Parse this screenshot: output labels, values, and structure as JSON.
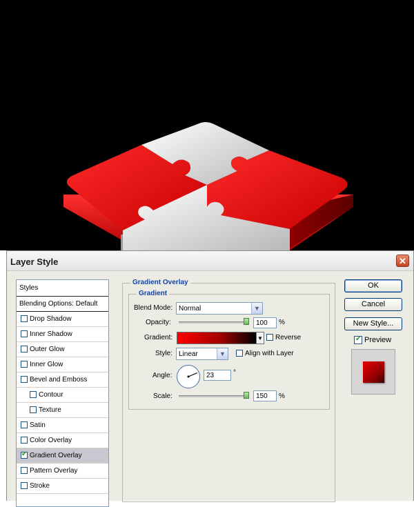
{
  "dialog": {
    "title": "Layer Style",
    "close_glyph": "✕"
  },
  "styles_panel": {
    "header": "Styles",
    "blending_options": "Blending Options: Default",
    "items": [
      {
        "label": "Drop Shadow",
        "checked": false
      },
      {
        "label": "Inner Shadow",
        "checked": false
      },
      {
        "label": "Outer Glow",
        "checked": false
      },
      {
        "label": "Inner Glow",
        "checked": false
      },
      {
        "label": "Bevel and Emboss",
        "checked": false
      },
      {
        "label": "Contour",
        "checked": false
      },
      {
        "label": "Texture",
        "checked": false
      },
      {
        "label": "Satin",
        "checked": false
      },
      {
        "label": "Color Overlay",
        "checked": false
      },
      {
        "label": "Gradient Overlay",
        "checked": true,
        "selected": true
      },
      {
        "label": "Pattern Overlay",
        "checked": false
      },
      {
        "label": "Stroke",
        "checked": false
      }
    ]
  },
  "gradient_overlay": {
    "section_title": "Gradient Overlay",
    "group_title": "Gradient",
    "blend_mode_label": "Blend Mode:",
    "blend_mode_value": "Normal",
    "opacity_label": "Opacity:",
    "opacity_value": "100",
    "opacity_percent": 100,
    "percent_sign": "%",
    "gradient_label": "Gradient:",
    "gradient_colors": [
      "#ff0000",
      "#a00000",
      "#000000"
    ],
    "reverse_label": "Reverse",
    "reverse_checked": false,
    "style_label": "Style:",
    "style_value": "Linear",
    "align_label": "Align with Layer",
    "align_checked": false,
    "angle_label": "Angle:",
    "angle_value": "23",
    "degree_sign": "°",
    "scale_label": "Scale:",
    "scale_value": "150",
    "scale_percent": 150
  },
  "buttons": {
    "ok": "OK",
    "cancel": "Cancel",
    "new_style": "New Style...",
    "preview_label": "Preview",
    "preview_checked": true
  },
  "colors": {
    "canvas_background": "#000000",
    "puzzle_red": "#ff0000",
    "puzzle_gray": "#d8d8d8",
    "accent_blue": "#1245a8"
  }
}
